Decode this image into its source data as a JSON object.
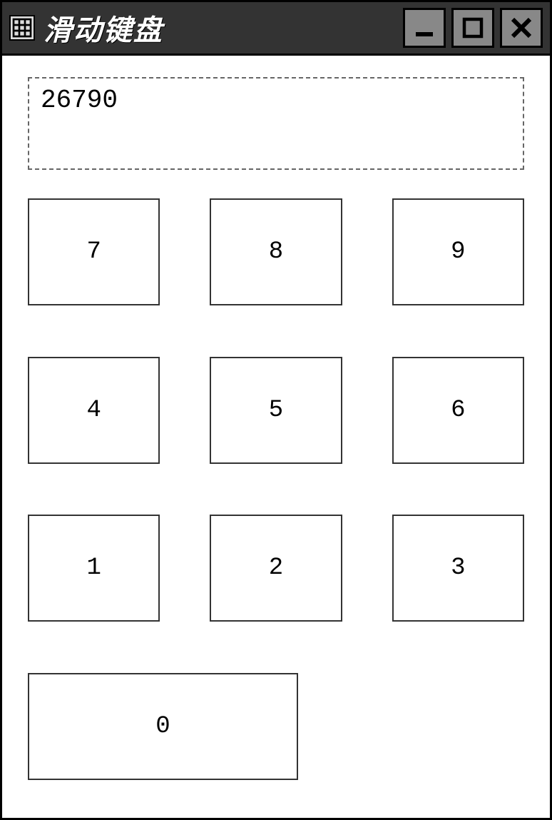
{
  "titlebar": {
    "title": "滑动键盘",
    "minimize_icon": "minimize",
    "maximize_icon": "maximize",
    "close_icon": "close"
  },
  "display": {
    "value": "26790"
  },
  "keypad": {
    "keys": [
      "7",
      "8",
      "9",
      "4",
      "5",
      "6",
      "1",
      "2",
      "3",
      "0"
    ]
  }
}
